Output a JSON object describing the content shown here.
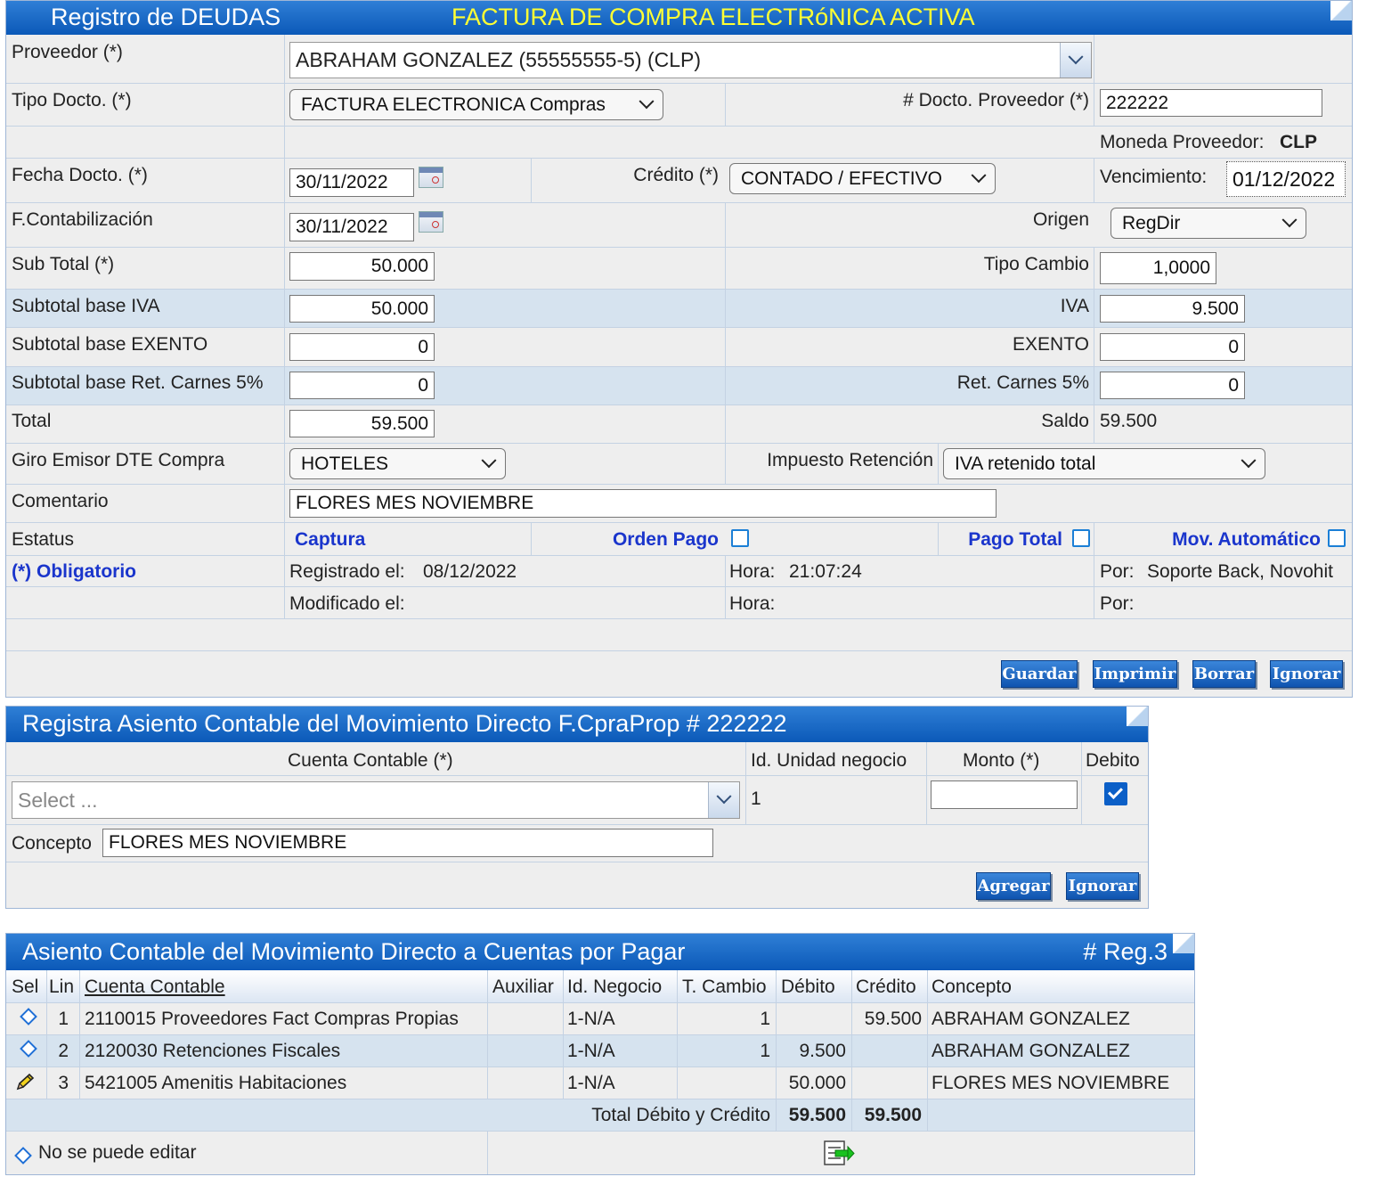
{
  "deudas": {
    "title": "Registro de DEUDAS",
    "status_banner": "FACTURA DE COMPRA ELECTRóNICA ACTIVA",
    "proveedor_label": "Proveedor (*)",
    "proveedor_value": "ABRAHAM GONZALEZ (55555555-5) (CLP)",
    "tipo_docto_label": "Tipo Docto. (*)",
    "tipo_docto_value": "FACTURA ELECTRONICA Compras",
    "docto_proveedor_label": "# Docto. Proveedor (*)",
    "docto_proveedor_value": "222222",
    "moneda_label": "Moneda Proveedor:",
    "moneda_value": "CLP",
    "fecha_docto_label": "Fecha Docto. (*)",
    "fecha_docto_value": "30/11/2022",
    "credito_label": "Crédito (*)",
    "credito_value": "CONTADO / EFECTIVO",
    "vencimiento_label": "Vencimiento:",
    "vencimiento_value": "01/12/2022",
    "f_contab_label": "F.Contabilización",
    "f_contab_value": "30/11/2022",
    "origen_label": "Origen",
    "origen_value": "RegDir",
    "subtotal_label": "Sub Total (*)",
    "subtotal_value": "50.000",
    "tipo_cambio_label": "Tipo Cambio",
    "tipo_cambio_value": "1,0000",
    "base_iva_label": "Subtotal base IVA",
    "base_iva_value": "50.000",
    "iva_label": "IVA",
    "iva_value": "9.500",
    "base_exento_label": "Subtotal base EXENTO",
    "base_exento_value": "0",
    "exento_label": "EXENTO",
    "exento_value": "0",
    "base_carnes_label": "Subtotal base Ret. Carnes 5%",
    "base_carnes_value": "0",
    "carnes_label": "Ret. Carnes 5%",
    "carnes_value": "0",
    "total_label": "Total",
    "total_value": "59.500",
    "saldo_label": "Saldo",
    "saldo_value": "59.500",
    "giro_label": "Giro Emisor DTE Compra",
    "giro_value": "HOTELES",
    "impuesto_ret_label": "Impuesto Retención",
    "impuesto_ret_value": "IVA retenido total",
    "comentario_label": "Comentario",
    "comentario_value": "FLORES MES NOVIEMBRE",
    "estatus_label": "Estatus",
    "captura_label": "Captura",
    "orden_pago_label": "Orden Pago",
    "pago_total_label": "Pago Total",
    "mov_auto_label": "Mov. Automático",
    "obligatorio_label": "(*) Obligatorio",
    "registrado_label": "Registrado el:",
    "registrado_value": "08/12/2022",
    "hora_label": "Hora:",
    "hora_value": "21:07:24",
    "por_label": "Por:",
    "por_value": "Soporte Back, Novohit",
    "modificado_label": "Modificado el:",
    "hora2_label": "Hora:",
    "por2_label": "Por:",
    "btn_guardar": "Guardar",
    "btn_imprimir": "Imprimir",
    "btn_borrar": "Borrar",
    "btn_ignorar": "Ignorar"
  },
  "asiento": {
    "title": "Registra Asiento Contable del Movimiento Directo F.CpraProp # 222222",
    "col_cuenta": "Cuenta Contable (*)",
    "col_unidad": "Id. Unidad negocio",
    "col_monto": "Monto (*)",
    "col_debito": "Debito",
    "cuenta_placeholder": "Select ...",
    "unidad_value": "1",
    "monto_value": "",
    "debito_checked": true,
    "concepto_label": "Concepto",
    "concepto_value": "FLORES MES NOVIEMBRE",
    "btn_agregar": "Agregar",
    "btn_ignorar": "Ignorar"
  },
  "movimiento": {
    "title": "Asiento Contable del Movimiento Directo a Cuentas por Pagar",
    "reg_count": "# Reg.3",
    "headers": [
      "Sel",
      "Lin",
      "Cuenta Contable",
      "Auxiliar",
      "Id. Negocio",
      "T. Cambio",
      "Débito",
      "Crédito",
      "Concepto"
    ],
    "rows": [
      {
        "lin": "1",
        "cuenta": "2110015 Proveedores Fact Compras Propias",
        "auxiliar": "",
        "negocio": "1-N/A",
        "tcambio": "1",
        "debito": "",
        "credito": "59.500",
        "concepto": "ABRAHAM GONZALEZ"
      },
      {
        "lin": "2",
        "cuenta": "2120030 Retenciones Fiscales",
        "auxiliar": "",
        "negocio": "1-N/A",
        "tcambio": "1",
        "debito": "9.500",
        "credito": "",
        "concepto": "ABRAHAM GONZALEZ"
      },
      {
        "lin": "3",
        "cuenta": "5421005 Amenitis Habitaciones",
        "auxiliar": "",
        "negocio": "1-N/A",
        "tcambio": "",
        "debito": "50.000",
        "credito": "",
        "concepto": "FLORES MES NOVIEMBRE"
      }
    ],
    "total_label": "Total Débito y Crédito",
    "total_debito": "59.500",
    "total_credito": "59.500",
    "legend_text": "No se puede editar",
    "icons": {
      "row_locked": "diamond-icon",
      "row_edit": "pencil-icon",
      "export": "export-icon"
    }
  },
  "colors": {
    "header_blue": "#0b59b8",
    "banner_yellow": "#ffff33",
    "link_blue": "#1a35cc",
    "band": "#d6e3ef"
  }
}
